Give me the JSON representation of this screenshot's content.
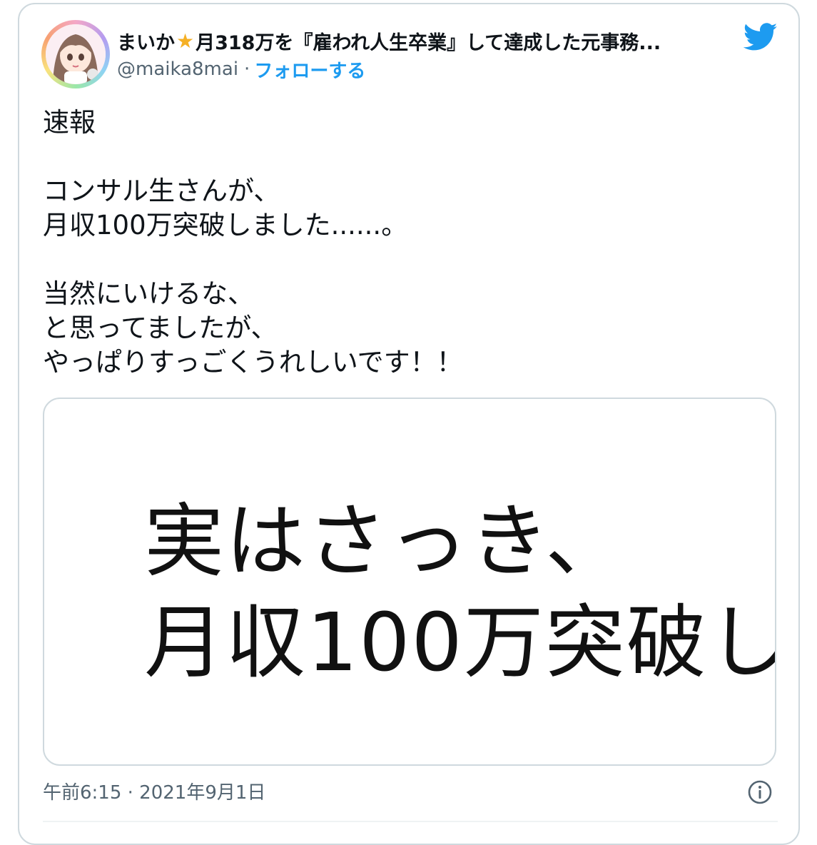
{
  "author": {
    "name_prefix": "まいか",
    "star_glyph": "★",
    "name_suffix": "月318万を『雇われ人生卒業』して達成した元事務...",
    "handle": "@maika8mai",
    "separator": "·",
    "follow_label": "フォローする"
  },
  "tweet": {
    "text": "速報\n\nコンサル生さんが、\n月収100万突破しました......。\n\n当然にいけるな、\nと思ってましたが、\nやっぱりすっごくうれしいです！！"
  },
  "media": {
    "line1": "実はさっき、",
    "line2": "月収100万突破し"
  },
  "footer": {
    "timestamp": "午前6:15 · 2021年9月1日"
  },
  "icons": {
    "brand": "twitter-bird-icon",
    "info": "info-icon",
    "star": "star-icon"
  },
  "colors": {
    "accent": "#1d9bf0",
    "secondary_text": "#536471",
    "border": "#cfd9de",
    "star": "#f5b025"
  }
}
